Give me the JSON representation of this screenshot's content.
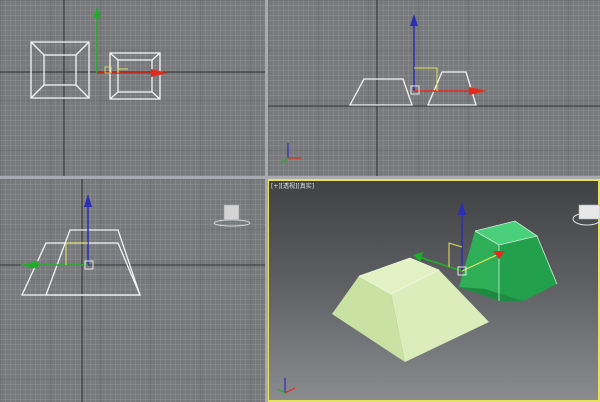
{
  "viewports": {
    "perspective": {
      "label": "[+][透视][真实]"
    }
  },
  "colors": {
    "accent_active": "#e6e35a",
    "gizmo_x": "#e32b1d",
    "gizmo_y": "#1fae2a",
    "gizmo_z": "#2a2fb3",
    "wire": "#f4f4f4",
    "selected_object": "#2fb35a",
    "object_light": "#cfe8b0"
  },
  "icons": [
    "axis-tripod-icon",
    "viewcube-icon",
    "move-gizmo-icon"
  ]
}
